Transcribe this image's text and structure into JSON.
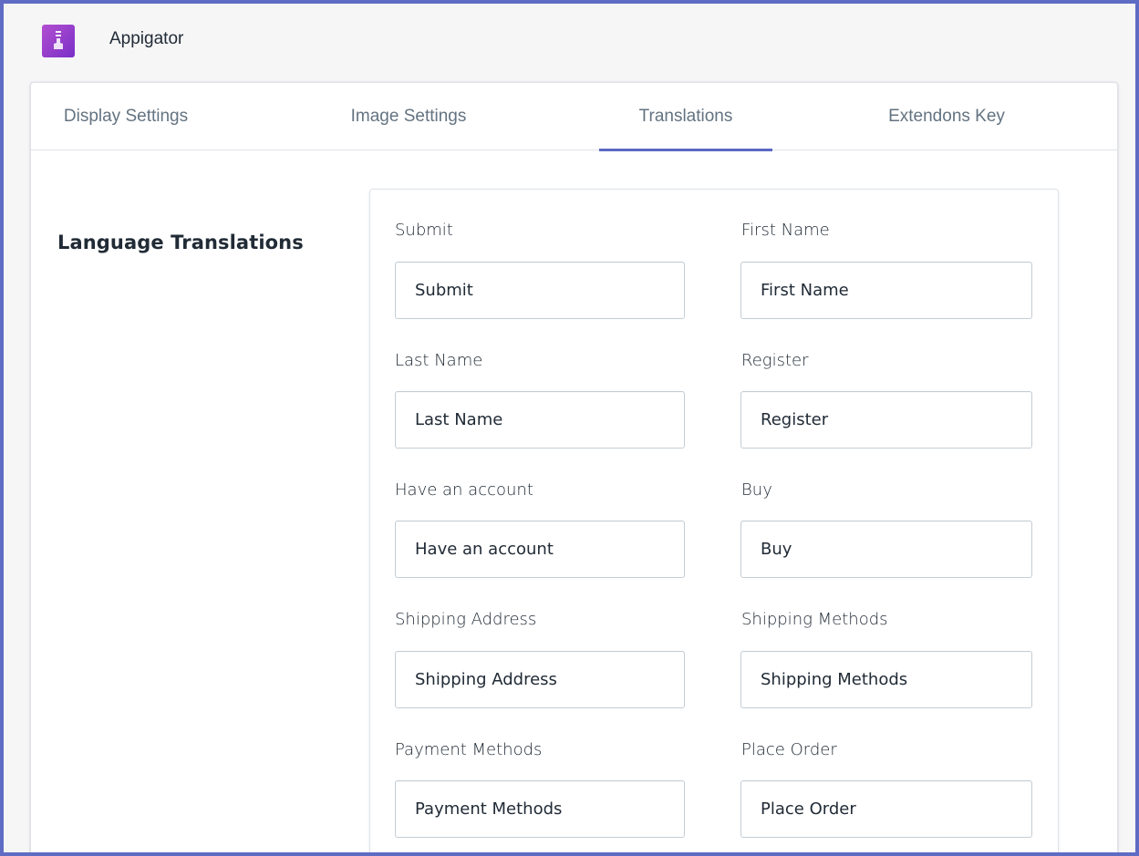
{
  "app": {
    "title": "Appigator",
    "logo_icon": "app-logo-icon",
    "accent_color": "#5c6ac4"
  },
  "tabs": [
    {
      "label": "Display Settings",
      "active": false
    },
    {
      "label": "Image Settings",
      "active": false
    },
    {
      "label": "Translations",
      "active": true
    },
    {
      "label": "Extendons Key",
      "active": false
    }
  ],
  "section": {
    "title": "Language Translations"
  },
  "fields": [
    {
      "label": "Submit",
      "value": "Submit"
    },
    {
      "label": "First Name",
      "value": "First Name"
    },
    {
      "label": "Last Name",
      "value": "Last Name"
    },
    {
      "label": "Register",
      "value": "Register"
    },
    {
      "label": "Have an account",
      "value": "Have an account"
    },
    {
      "label": "Buy",
      "value": "Buy"
    },
    {
      "label": "Shipping Address",
      "value": "Shipping Address"
    },
    {
      "label": "Shipping Methods",
      "value": "Shipping Methods"
    },
    {
      "label": "Payment Methods",
      "value": "Payment Methods"
    },
    {
      "label": "Place Order",
      "value": "Place Order"
    }
  ]
}
